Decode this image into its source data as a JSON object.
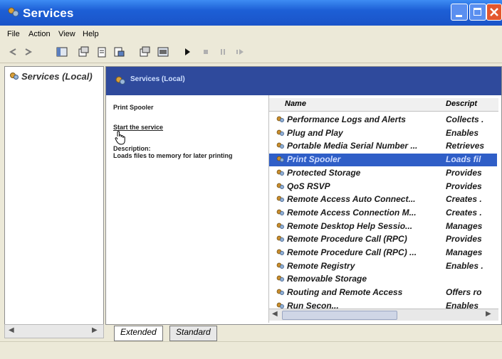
{
  "window": {
    "title": "Services",
    "controls": [
      "minimize",
      "maximize",
      "close"
    ]
  },
  "menu": [
    "File",
    "Action",
    "View",
    "Help"
  ],
  "toolbar": {
    "buttons": [
      "back-icon",
      "forward-icon",
      "console-tree-icon",
      "properties-icon",
      "refresh-icon",
      "export-icon",
      "help-icon",
      "show-hide-icon",
      "start-icon",
      "stop-icon",
      "pause-icon",
      "restart-icon"
    ]
  },
  "left_tree": {
    "item": "Services (Local)"
  },
  "right_header": {
    "label": "Services (Local)"
  },
  "details": {
    "service_name": "Print Spooler",
    "start_link": "Start the service",
    "description_label": "Description:",
    "description_text": "Loads files to memory for later printing"
  },
  "list": {
    "columns": [
      "Name",
      "Descript"
    ],
    "rows": [
      {
        "name": "Performance Logs and Alerts",
        "desc": "Collects ."
      },
      {
        "name": "Plug and Play",
        "desc": "Enables"
      },
      {
        "name": "Portable Media Serial Number ...",
        "desc": "Retrieves"
      },
      {
        "name": "Print Spooler",
        "desc": "Loads fil",
        "selected": true
      },
      {
        "name": "Protected Storage",
        "desc": "Provides"
      },
      {
        "name": "QoS RSVP",
        "desc": "Provides"
      },
      {
        "name": "Remote Access Auto Connect...",
        "desc": "Creates ."
      },
      {
        "name": "Remote Access Connection M...",
        "desc": "Creates ."
      },
      {
        "name": "Remote Desktop Help Sessio...",
        "desc": "Manages"
      },
      {
        "name": "Remote Procedure Call (RPC)",
        "desc": "Provides"
      },
      {
        "name": "Remote Procedure Call (RPC) ...",
        "desc": "Manages"
      },
      {
        "name": "Remote Registry",
        "desc": "Enables ."
      },
      {
        "name": "Removable Storage",
        "desc": ""
      },
      {
        "name": "Routing and Remote Access",
        "desc": "Offers ro"
      },
      {
        "name": "Run Secon...",
        "desc": "Enables"
      }
    ]
  },
  "tabs": [
    "Extended",
    "Standard"
  ],
  "colors": {
    "title_bar": "#1d5fd6",
    "selection": "#2f5ec7",
    "header_band": "#2f4a9c"
  }
}
